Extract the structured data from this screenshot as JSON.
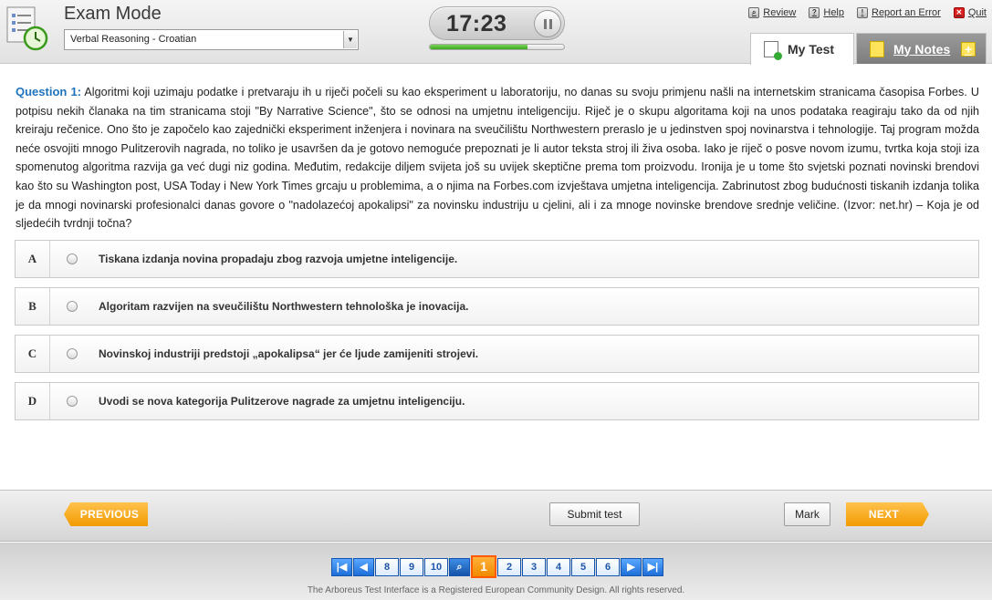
{
  "header": {
    "title": "Exam Mode",
    "test_selected": "Verbal Reasoning - Croatian",
    "timer": "17:23",
    "progress": 0.73,
    "links": [
      {
        "label": "Review",
        "icon": "review-icon"
      },
      {
        "label": "Help",
        "icon": "help-icon"
      },
      {
        "label": "Report an Error",
        "icon": "warning-icon"
      },
      {
        "label": "Quit",
        "icon": "quit-icon"
      }
    ],
    "tabs": {
      "my_test": "My Test",
      "my_notes": "My Notes"
    }
  },
  "question": {
    "label": "Question 1:",
    "text": "Algoritmi koji uzimaju podatke i pretvaraju ih u riječi počeli su kao eksperiment u laboratoriju, no danas su svoju primjenu našli na internetskim stranicama časopisa Forbes. U potpisu nekih članaka na tim stranicama stoji \"By Narrative Science\", što se odnosi na umjetnu inteligenciju. Riječ je o skupu algoritama koji na unos podataka reagiraju tako da od njih kreiraju rečenice. Ono što je započelo kao zajednički eksperiment inženjera i novinara na sveučilištu Northwestern preraslo je u jedinstven spoj novinarstva i tehnologije. Taj program možda neće osvojiti mnogo Pulitzerovih nagrada, no toliko je usavršen da je gotovo nemoguće prepoznati je li autor teksta stroj ili živa osoba. Iako je riječ o posve novom izumu, tvrtka koja stoji iza spomenutog algoritma razvija ga već dugi niz godina. Međutim, redakcije diljem svijeta još su uvijek skeptične prema tom proizvodu. Ironija je u tome što svjetski poznati novinski brendovi kao što su Washington post, USA Today i New York Times grcaju u problemima, a o njima na Forbes.com izvještava umjetna inteligencija. Zabrinutost zbog budućnosti tiskanih izdanja tolika je da mnogi novinarski profesionalci danas govore o \"nadolazećoj apokalipsi\" za novinsku industriju u cjelini, ali i za mnoge novinske brendove srednje veličine. (Izvor: net.hr) – Koja je od sljedećih tvrdnji točna?"
  },
  "answers": [
    {
      "letter": "A",
      "text": "Tiskana izdanja novina propadaju zbog razvoja umjetne inteligencije."
    },
    {
      "letter": "B",
      "text": "Algoritam razvijen na sveučilištu Northwestern tehnološka je inovacija."
    },
    {
      "letter": "C",
      "text": "Novinskoj industriji predstoji „apokalipsa“ jer će ljude zamijeniti strojevi."
    },
    {
      "letter": "D",
      "text": "Uvodi se nova kategorija Pulitzerove nagrade za umjetnu inteligenciju."
    }
  ],
  "nav": {
    "previous": "PREVIOUS",
    "submit": "Submit test",
    "mark": "Mark",
    "next": "NEXT"
  },
  "pager": {
    "before": [
      "8",
      "9",
      "10"
    ],
    "current": "1",
    "after": [
      "2",
      "3",
      "4",
      "5",
      "6"
    ]
  },
  "footer": {
    "copyright": "The Arboreus Test Interface is a Registered European Community Design. All rights reserved."
  }
}
